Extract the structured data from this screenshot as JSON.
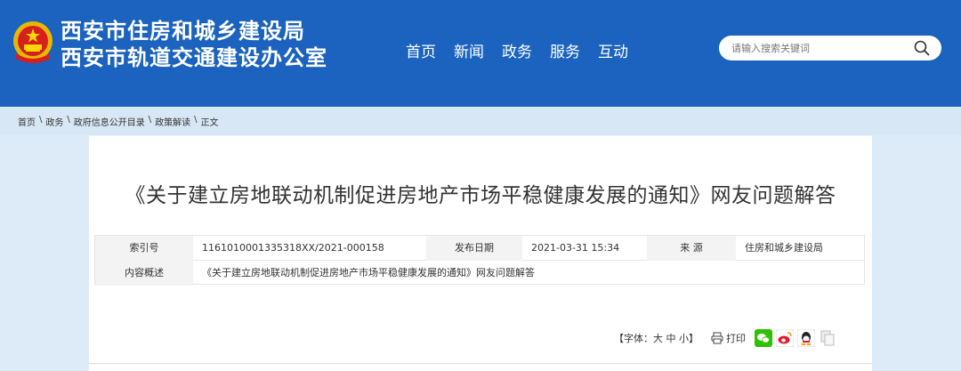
{
  "header": {
    "title_line1": "西安市住房和城乡建设局",
    "title_line2": "西安市轨道交通建设办公室",
    "nav": [
      "首页",
      "新闻",
      "政务",
      "服务",
      "互动"
    ],
    "search_placeholder": "请输入搜索关键词"
  },
  "breadcrumb": [
    "首页",
    "政务",
    "政府信息公开目录",
    "政策解读",
    "正文"
  ],
  "breadcrumb_sep": "\\",
  "article": {
    "title": "《关于建立房地联动机制促进房地产市场平稳健康发展的通知》网友问题解答"
  },
  "meta": {
    "index_label": "索引号",
    "index_value": "1161010001335318XX/2021-000158",
    "date_label": "发布日期",
    "date_value": "2021-03-31 15:34",
    "source_label": "来    源",
    "source_value": "住房和城乡建设局",
    "summary_label": "内容概述",
    "summary_value": "《关于建立房地联动机制促进房地产市场平稳健康发展的通知》网友问题解答"
  },
  "tools": {
    "font_prefix": "【字体：",
    "font_large": "大",
    "font_medium": "中",
    "font_small": "小",
    "font_suffix": "】",
    "print_label": "打印"
  },
  "colors": {
    "header_bg": "#1b63be",
    "page_bg": "#dcebf7",
    "panel_bg": "#ffffff"
  },
  "icons": [
    "national-emblem-icon",
    "search-icon",
    "printer-icon",
    "wechat-share-icon",
    "weibo-share-icon",
    "qq-share-icon",
    "copy-link-icon"
  ]
}
